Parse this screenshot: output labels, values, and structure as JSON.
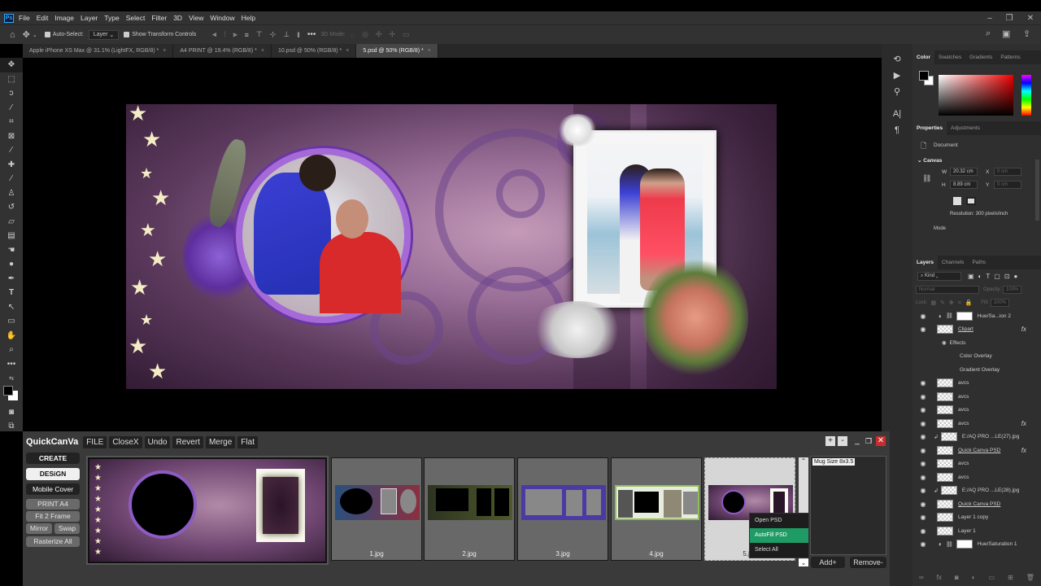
{
  "app": {
    "name": "Adobe Photoshop",
    "logo": "Ps"
  },
  "menu": [
    "File",
    "Edit",
    "Image",
    "Layer",
    "Type",
    "Select",
    "Filter",
    "3D",
    "View",
    "Window",
    "Help"
  ],
  "window_controls": {
    "minimize": "–",
    "restore": "❐",
    "close": "✕"
  },
  "options_bar": {
    "auto_select_label": "Auto-Select:",
    "auto_select_checked": true,
    "auto_select_target": "Layer",
    "show_transform_label": "Show Transform Controls",
    "show_transform_checked": true,
    "mode_3d_label": "3D Mode:",
    "more": "•••"
  },
  "doc_tabs": [
    {
      "label": "Apple iPhone XS Max @ 31.1% (LightFX, RGB/8) *",
      "active": false
    },
    {
      "label": "A4 PRINT @ 19.4% (RGB/8) *",
      "active": false
    },
    {
      "label": "10.psd @ 50% (RGB/8) *",
      "active": false
    },
    {
      "label": "5.psd @ 50% (RGB/8) *",
      "active": true
    }
  ],
  "tools": [
    "move",
    "marquee",
    "lasso",
    "magic-wand",
    "crop",
    "frame",
    "eyedropper",
    "healing",
    "brush",
    "stamp",
    "history-brush",
    "eraser",
    "gradient",
    "smudge",
    "dodge",
    "pen",
    "type",
    "path-select",
    "rectangle",
    "hand",
    "zoom",
    "more"
  ],
  "color_panel": {
    "tabs": [
      "Color",
      "Swatches",
      "Gradients",
      "Patterns"
    ],
    "active": "Color",
    "foreground": "#000000",
    "background": "#ffffff",
    "hue": "#ff0000"
  },
  "properties_panel": {
    "tabs": [
      "Properties",
      "Adjustments"
    ],
    "active": "Properties",
    "type": "Document",
    "section": "Canvas",
    "width_label": "W",
    "width": "20.32 cm",
    "height_label": "H",
    "height": "8.89 cm",
    "x_label": "X",
    "x": "0 cm",
    "y_label": "Y",
    "y": "0 cm",
    "resolution": "Resolution: 300 pixels/inch",
    "mode_label": "Mode"
  },
  "layers_panel": {
    "tabs": [
      "Layers",
      "Channels",
      "Paths"
    ],
    "active": "Layers",
    "filter": "Kind",
    "blend_mode": "Normal",
    "opacity_label": "Opacity:",
    "opacity": "100%",
    "lock_label": "Lock:",
    "fill_label": "Fill:",
    "fill": "100%",
    "layers": [
      {
        "name": "Hue/Sa...ion 2",
        "kind": "adjustment",
        "fx": false
      },
      {
        "name": "Clipart",
        "kind": "pixel",
        "fx": true
      },
      {
        "name": "Effects",
        "kind": "effects-header",
        "fx": false
      },
      {
        "name": "Color Overlay",
        "kind": "effect",
        "fx": false
      },
      {
        "name": "Gradient Overlay",
        "kind": "effect",
        "fx": false
      },
      {
        "name": "avcs",
        "kind": "pixel",
        "fx": false
      },
      {
        "name": "avcs",
        "kind": "pixel",
        "fx": false
      },
      {
        "name": "avcs",
        "kind": "pixel",
        "fx": false
      },
      {
        "name": "avcs",
        "kind": "pixel",
        "fx": true
      },
      {
        "name": "E:/AQ PRO ...LE(27).jpg",
        "kind": "smart",
        "fx": false
      },
      {
        "name": "Quick Canva PSD",
        "kind": "group",
        "fx": true
      },
      {
        "name": "avcs",
        "kind": "pixel",
        "fx": false
      },
      {
        "name": "avcs",
        "kind": "pixel",
        "fx": false
      },
      {
        "name": "E:/AQ PRO ...LE(28).jpg",
        "kind": "smart",
        "fx": false
      },
      {
        "name": "Quick Canva PSD",
        "kind": "group",
        "fx": false
      },
      {
        "name": "Layer 1 copy",
        "kind": "pixel",
        "fx": false
      },
      {
        "name": "Layer 1",
        "kind": "pixel",
        "fx": false
      },
      {
        "name": "Hue/Saturation 1",
        "kind": "adjustment",
        "fx": false
      }
    ]
  },
  "quickcanva": {
    "brand": "QuickCanVa",
    "top_buttons": [
      "FILE",
      "CloseX",
      "Undo",
      "Revert",
      "Merge",
      "Flat"
    ],
    "left_buttons": {
      "create": "CREATE",
      "design": "DESiGN",
      "mobile_cover": "Mobile Cover",
      "print_a4": "PRINT A4",
      "fit2frame": "Fit 2 Frame",
      "mirror": "Mirror",
      "swap": "Swap",
      "rasterize": "Rasterize All"
    },
    "thumbnails": [
      "1.jpg",
      "2.jpg",
      "3.jpg",
      "4.jpg",
      "5.jpg"
    ],
    "selected_thumbnail": "5.jpg",
    "context_menu": [
      "Open PSD",
      "AutoFill PSD",
      "Select All"
    ],
    "context_highlight": "AutoFill PSD",
    "size_list": [
      "Mug Size 8x3.5"
    ],
    "add_label": "Add+",
    "remove_label": "Remove-",
    "plus": "+",
    "minus": "-"
  }
}
